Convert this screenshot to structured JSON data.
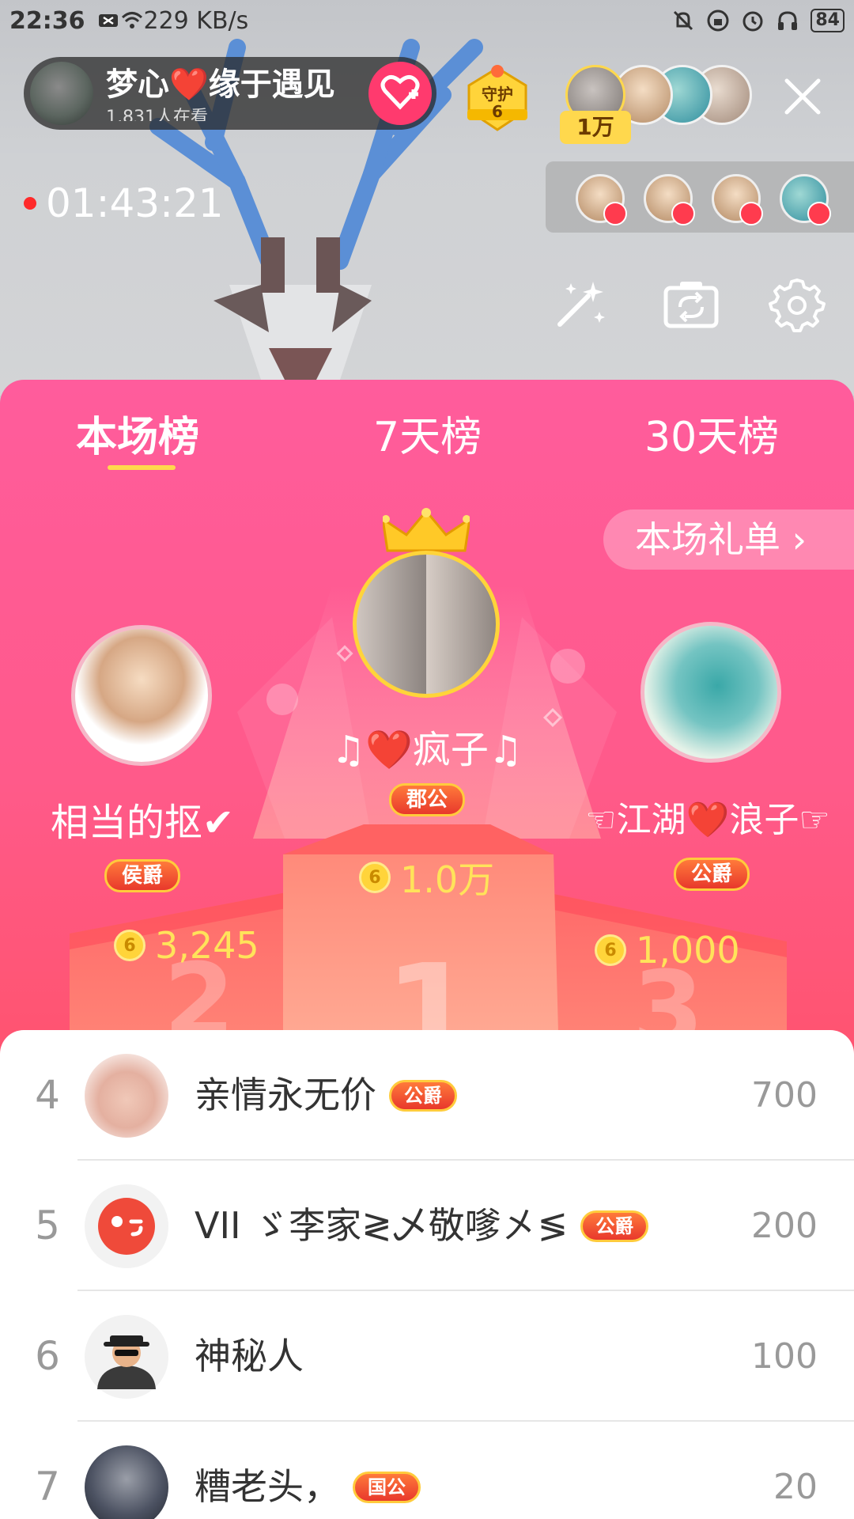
{
  "status_bar": {
    "time": "22:36",
    "net_speed": "229 KB/s",
    "battery": "84"
  },
  "host": {
    "name": "梦心❤️缘于遇见",
    "viewers": "1,831人在看"
  },
  "guard": {
    "label": "守护",
    "count": "6"
  },
  "viewer_count": "1万",
  "live_timer": "01:43:21",
  "tabs": [
    {
      "label": "本场榜",
      "active": true
    },
    {
      "label": "7天榜",
      "active": false
    },
    {
      "label": "30天榜",
      "active": false
    }
  ],
  "gift_list_button": "本场礼单 ›",
  "top3": {
    "first": {
      "name": "♫❤️疯子♫",
      "title": "郡公",
      "score": "1.0万"
    },
    "second": {
      "name": "相当的抠✔",
      "title": "侯爵",
      "score": "3,245"
    },
    "third": {
      "name": "☜江湖❤️浪子☞",
      "title": "公爵",
      "score": "1,000"
    }
  },
  "podium_numbers": [
    "2",
    "1",
    "3"
  ],
  "ranking": [
    {
      "rank": "4",
      "name": "亲情永无价",
      "title": "公爵",
      "score": "700"
    },
    {
      "rank": "5",
      "name": "VII ゞ李家≷乄敬嗲㐅≶",
      "title": "公爵",
      "score": "200"
    },
    {
      "rank": "6",
      "name": "神秘人",
      "title": "",
      "score": "100"
    },
    {
      "rank": "7",
      "name": "糟老头，",
      "title": "国公",
      "score": "20"
    }
  ],
  "colors": {
    "panel_top": "#ff5c9c",
    "panel_bottom": "#ff4a62",
    "accent_gold": "#ffd84d",
    "follow_button": "#ff3a6e"
  },
  "icons": {
    "follow": "heart-plus-icon",
    "close": "close-icon",
    "beauty": "magic-wand-icon",
    "flip_camera": "camera-flip-icon",
    "settings": "gear-icon",
    "crown": "crown-icon",
    "coin": "coin-icon"
  }
}
